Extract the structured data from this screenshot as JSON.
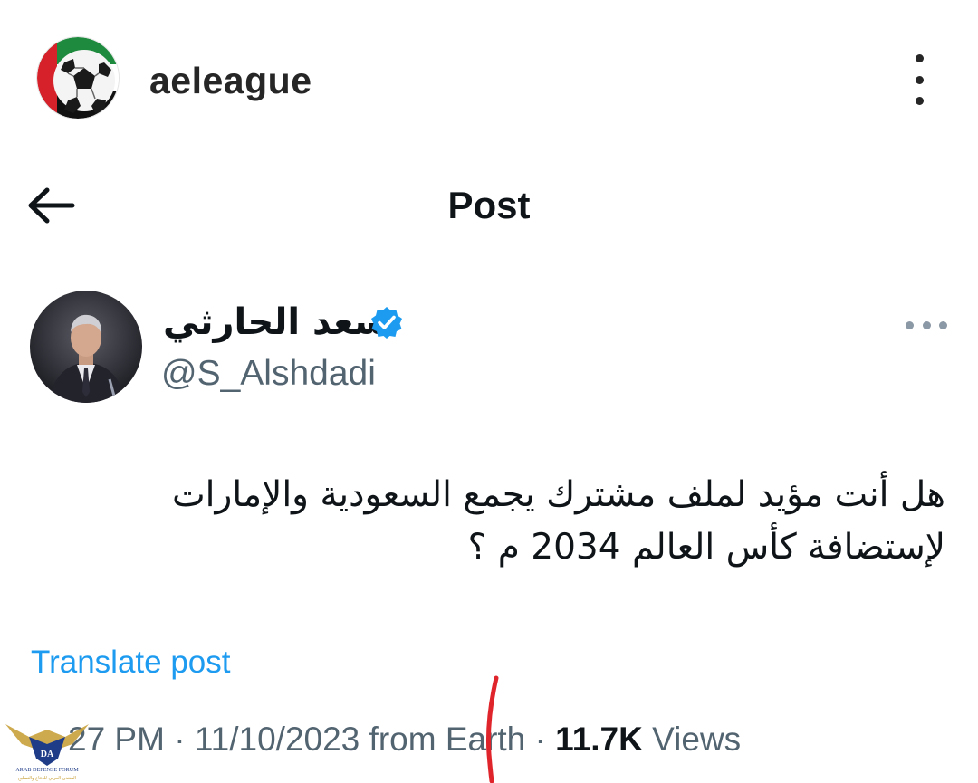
{
  "ig": {
    "username": "aeleague",
    "avatar_icon": "ball-logo-icon",
    "more_icon": "more-vertical-icon"
  },
  "nav": {
    "title": "Post",
    "back_icon": "arrow-left-icon"
  },
  "author": {
    "name": "سعد الحارثي",
    "handle": "@S_Alshdadi",
    "verified_icon": "verified-badge-icon",
    "more_icon": "more-horizontal-icon"
  },
  "post": {
    "text": "هل أنت مؤيد لملف مشترك يجمع السعودية والإمارات\nلإستضافة كأس العالم 2034 م ؟",
    "translate_label": "Translate post"
  },
  "meta": {
    "time": "27 PM",
    "separator": "·",
    "date": "11/10/2023",
    "source": "from Earth",
    "views_count": "11.7K",
    "views_label": "Views"
  },
  "watermark": {
    "line1": "DA",
    "line2": "ARAB DEFENSE FORUM",
    "line3": "المنتدى العربي للدفاع والتسليح"
  },
  "colors": {
    "accent": "#1d9bf0",
    "secondary_text": "#536471",
    "primary_text": "#0f1419",
    "verified": "#1d9bf0",
    "annotation": "#e0242b"
  }
}
